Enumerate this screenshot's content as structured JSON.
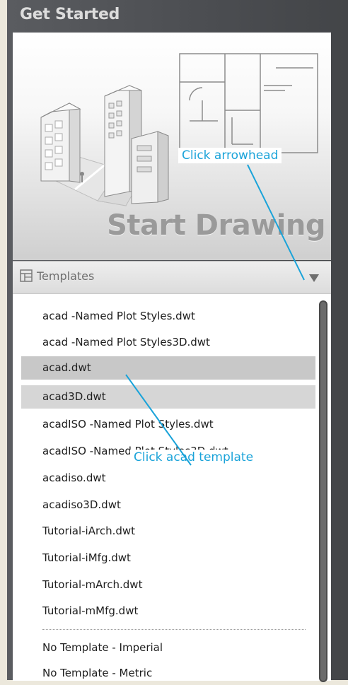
{
  "panel": {
    "title": "Get Started"
  },
  "tile": {
    "label": "Start Drawing",
    "callout": "Click arrowhead"
  },
  "templates": {
    "label": "Templates",
    "items": [
      {
        "label": "acad -Named Plot Styles.dwt"
      },
      {
        "label": "acad -Named Plot Styles3D.dwt"
      },
      {
        "label": "acad.dwt"
      },
      {
        "label": "acad3D.dwt"
      },
      {
        "label": "acadISO -Named Plot Styles.dwt"
      },
      {
        "label": "acadISO -Named Plot Styles3D.dwt"
      },
      {
        "label": "acadiso.dwt"
      },
      {
        "label": "acadiso3D.dwt"
      },
      {
        "label": "Tutorial-iArch.dwt"
      },
      {
        "label": "Tutorial-iMfg.dwt"
      },
      {
        "label": "Tutorial-mArch.dwt"
      },
      {
        "label": "Tutorial-mMfg.dwt"
      },
      {
        "label": "No Template - Imperial"
      },
      {
        "label": "No Template - Metric"
      }
    ],
    "callout": "Click acad template"
  },
  "colors": {
    "callout_text": "#1aa3d9",
    "callout_line": "#1aa3d9",
    "panel_bg": "#4b4d51",
    "selected_row": "#c8c8c8"
  }
}
